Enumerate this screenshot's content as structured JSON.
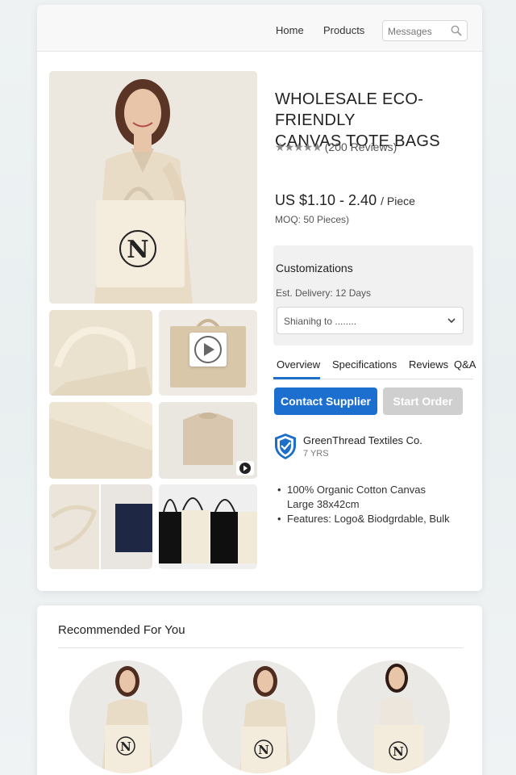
{
  "nav": {
    "home": "Home",
    "products": "Products",
    "search_placeholder": "Messages"
  },
  "product": {
    "title_line1": "WHOLESALE ECO-FRIENDLY",
    "title_line2": "CANVAS TOTE BAGS",
    "stars": "★★★★★",
    "rating_value": 4.5,
    "reviews": "(200 Reviews)",
    "price": "US $1.10 - 2.40",
    "price_unit": "/ Piece",
    "moq": "MOQ: 50 Pieces)"
  },
  "customization": {
    "title": "Customizations",
    "delivery": "Est. Delivery: 12 Days",
    "shipping": "Shianihg to ........"
  },
  "tabs": [
    {
      "label": "Overview"
    },
    {
      "label": "Specifications"
    },
    {
      "label": "Reviews"
    },
    {
      "label": "Q&A"
    }
  ],
  "actions": {
    "contact": "Contact Supplier",
    "order": "Start Order"
  },
  "supplier": {
    "name": "GreenThread Textiles Co.",
    "years": "7 YRS"
  },
  "features": {
    "line1": "100% Organic Cotton Canvas",
    "line2": "Large 38x42cm",
    "line3": "Features: Logo& Biodgrdable, Bulk"
  },
  "logo_letter": "N",
  "recommended": {
    "title": "Recommended For You"
  },
  "colors": {
    "accent": "#1d6fcf",
    "disabled": "#cfcfcf",
    "shield": "#1e6fc9"
  },
  "icons": [
    "search-icon",
    "play-icon",
    "chevron-down-icon",
    "shield-check-icon"
  ]
}
